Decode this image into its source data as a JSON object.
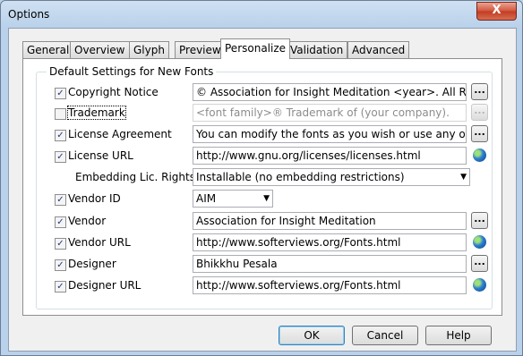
{
  "window": {
    "title": "Options",
    "close": "X"
  },
  "tabs": [
    "General",
    "Overview",
    "Glyph",
    "Preview",
    "Personalize",
    "Validation",
    "Advanced"
  ],
  "active_tab": "Personalize",
  "group_title": "Default Settings for New Fonts",
  "rows": [
    {
      "label": "Copyright Notice",
      "checked": true,
      "value": "© Association for Insight Meditation <year>. All Rights",
      "control": "browse"
    },
    {
      "label": "Trademark",
      "checked": false,
      "value": "<font family>® Trademark of (your company).",
      "control": "browse",
      "disabled": true
    },
    {
      "label": "License Agreement",
      "checked": true,
      "value": "You can modify the fonts as you wish or use any of the g",
      "control": "browse"
    },
    {
      "label": "License URL",
      "checked": true,
      "value": "http://www.gnu.org/licenses/licenses.html",
      "control": "globe"
    },
    {
      "label": "Embedding Lic. Rights",
      "value": "Installable (no embedding restrictions)",
      "control": "combo"
    },
    {
      "label": "Vendor ID",
      "checked": true,
      "value": "AIM",
      "control": "combo-small"
    },
    {
      "label": "Vendor",
      "checked": true,
      "value": "Association for Insight Meditation",
      "control": "browse"
    },
    {
      "label": "Vendor URL",
      "checked": true,
      "value": "http://www.softerviews.org/Fonts.html",
      "control": "globe"
    },
    {
      "label": "Designer",
      "checked": true,
      "value": "Bhikkhu Pesala",
      "control": "browse"
    },
    {
      "label": "Designer URL",
      "checked": true,
      "value": "http://www.softerviews.org/Fonts.html",
      "control": "globe"
    }
  ],
  "buttons": {
    "ok": "OK",
    "cancel": "Cancel",
    "help": "Help"
  },
  "browse_label": "...",
  "colors": {
    "title_bar": "#b9d1ea",
    "close": "#c23b22"
  }
}
